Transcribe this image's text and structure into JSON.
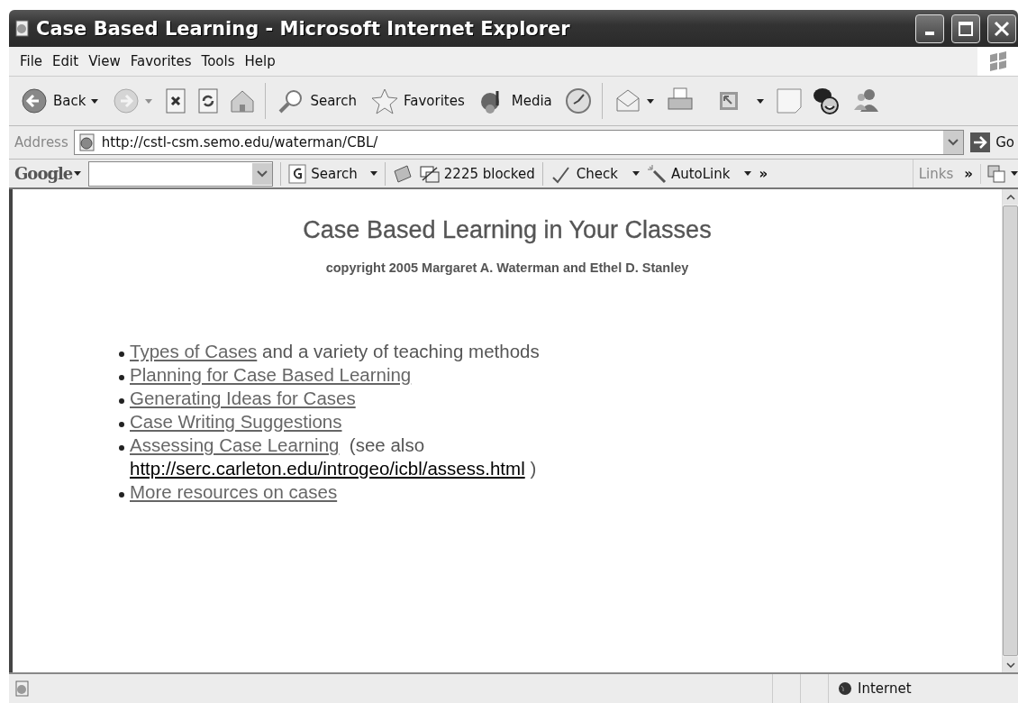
{
  "window": {
    "title": "Case Based Learning - Microsoft Internet Explorer"
  },
  "menu": [
    "File",
    "Edit",
    "View",
    "Favorites",
    "Tools",
    "Help"
  ],
  "toolbar": {
    "back": "Back",
    "forward_disabled": true,
    "search": "Search",
    "favorites": "Favorites",
    "media": "Media"
  },
  "address": {
    "label": "Address",
    "value": "http://cstl-csm.semo.edu/waterman/CBL/",
    "go": "Go"
  },
  "google_bar": {
    "logo": "Google",
    "search": "Search",
    "blocked": "2225 blocked",
    "check": "Check",
    "autolink": "AutoLink",
    "more": "»",
    "links": "Links",
    "links_more": "»"
  },
  "page": {
    "heading": "Case Based Learning in Your Classes",
    "copyright": "copyright 2005 Margaret A. Waterman and Ethel D. Stanley",
    "items": [
      {
        "parts": [
          {
            "kind": "link",
            "text": "Types of Cases"
          },
          {
            "kind": "text",
            "text": " and a variety of teaching methods"
          }
        ]
      },
      {
        "parts": [
          {
            "kind": "link",
            "text": "Planning for Case Based Learning"
          }
        ]
      },
      {
        "parts": [
          {
            "kind": "link",
            "text": "Generating Ideas for Cases"
          }
        ]
      },
      {
        "parts": [
          {
            "kind": "link",
            "text": "Case Writing Suggestions"
          }
        ]
      },
      {
        "parts": [
          {
            "kind": "link",
            "text": "Assessing Case Learning"
          },
          {
            "kind": "text",
            "text": "  (see also"
          },
          {
            "kind": "url",
            "text": "http://serc.carleton.edu/introgeo/icbl/assess.html"
          },
          {
            "kind": "text",
            "text": " )"
          }
        ]
      },
      {
        "parts": [
          {
            "kind": "link",
            "text": "More resources on cases"
          }
        ]
      }
    ]
  },
  "status_bar": {
    "zone": "Internet"
  }
}
